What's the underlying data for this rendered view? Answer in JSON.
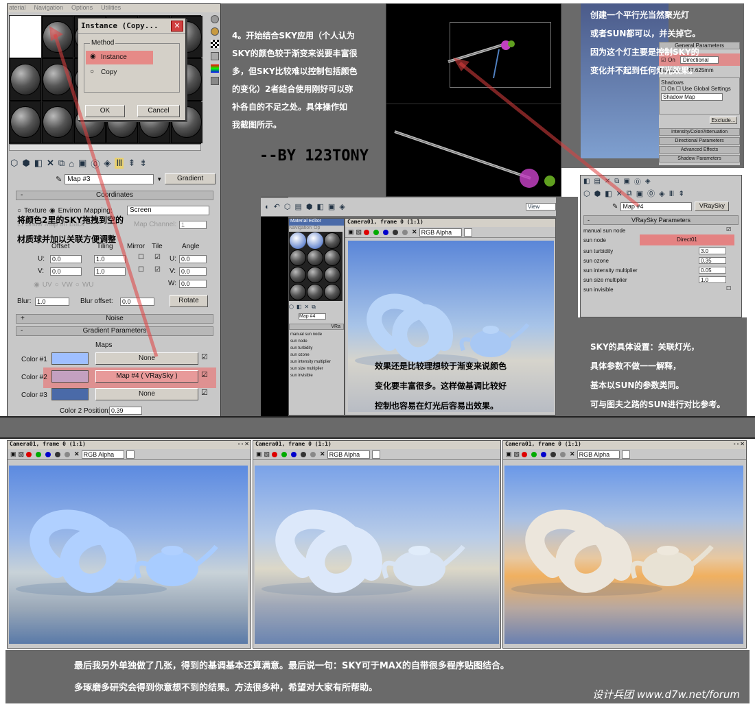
{
  "colors": {
    "bg_gray": "#6a6a6a",
    "highlight_red": "#f07070",
    "sky_blue": "#6f9be6",
    "sky_horizon": "#d8d6cc",
    "sky_warm": "#f0b060"
  },
  "menu_bar": [
    "aterial",
    "Navigation",
    "Options",
    "Utilities"
  ],
  "instance_dialog": {
    "title": "Instance (Copy...",
    "group_label": "Method",
    "option_instance": "Instance",
    "option_copy": "Copy",
    "ok": "OK",
    "cancel": "Cancel"
  },
  "material_panel": {
    "map_name": "Map #3",
    "map_type": "Gradient",
    "coordinates_title": "Coordinates",
    "texture_label": "Texture",
    "environ_label": "Environ",
    "mapping_label": "Mapping:",
    "mapping_value": "Screen",
    "show_map_label": "Show Map on Back",
    "map_channel_label": "Map Channel:",
    "map_channel_value": "1",
    "offset_label": "Offset",
    "tiling_label": "Tiling",
    "mirror_label": "Mirror",
    "tile_label": "Tile",
    "angle_label": "Angle",
    "u_label": "U:",
    "v_label": "V:",
    "w_label": "W:",
    "u_offset": "0.0",
    "v_offset": "0.0",
    "u_tiling": "1.0",
    "v_tiling": "1.0",
    "u_angle": "0.0",
    "v_angle": "0.0",
    "w_angle": "0.0",
    "uv": "UV",
    "vw": "VW",
    "wu": "WU",
    "blur_label": "Blur:",
    "blur_value": "1.0",
    "blur_offset_label": "Blur offset:",
    "blur_offset_value": "0.0",
    "rotate": "Rotate",
    "noise_title": "Noise",
    "gradient_title": "Gradient Parameters",
    "maps_label": "Maps",
    "color1": "Color #1",
    "color2": "Color #2",
    "color3": "Color #3",
    "none1": "None",
    "map4": "Map #4 ( VRaySky )",
    "none3": "None",
    "color2_pos_label": "Color 2 Position:",
    "color2_pos_value": "0.39",
    "plus": "+",
    "minus": "-",
    "color1_hex": "#9fbfff",
    "color2_hex": "#c3a0c0",
    "color3_hex": "#4a6aa8"
  },
  "annotations": {
    "drag_note_1": "将颜色2里的SKY拖拽到空的",
    "drag_note_2": "材质球并加以关联方便调整",
    "step4_lines": [
      "4。开始结合SKY应用（个人认为",
      "SKY的颜色较于渐变来说要丰富很",
      "多，但SKY比较难以控制包括颜色",
      "的变化）2者结合使用刚好可以弥",
      "补各自的不足之处。具体操作如",
      "我截图所示。"
    ],
    "author": "--BY 123TONY",
    "light_note": [
      "创建一个平行光当然聚光灯",
      "或者SUN都可以，并关掉它。",
      "因为这个灯主要是控制SKY的",
      "变化并不起到任何灯光效果。"
    ],
    "effect_note": [
      "效果还是比较理想较于渐变来说颜色",
      "变化要丰富很多。这样做基调比较好",
      "控制也容易在灯光后容易出效果。"
    ],
    "sky_note": [
      "SKY的具体设置：关联灯光，",
      "具体参数不做一一解释，",
      "基本以SUN的参数类同。",
      "可与图夫之路的SUN进行对比参考。"
    ],
    "bottom_line1": "最后我另外单独做了几张，得到的基调基本还算满意。最后说一句：SKY可于MAX的自带很多程序贴图结合。",
    "bottom_line2": "多琢磨多研究会得到你意想不到的结果。方法很多种，希望对大家有所帮助。",
    "watermark": "设计兵团 www.d7w.net/forum"
  },
  "light_panel": {
    "general_params": "General Parameters",
    "on_label": "On",
    "light_type": "Directional",
    "targeted": "Targeted:",
    "target_dist": "147.625mm",
    "shadows_label": "Shadows",
    "shadows_on": "On",
    "use_global": "Use Global Settings",
    "shadow_type": "Shadow Map",
    "exclude": "Exclude...",
    "rollouts": [
      "Intensity/Color/Attenuation",
      "Directional Parameters",
      "Advanced Effects",
      "Shadow Parameters"
    ]
  },
  "vraysky_panel": {
    "map_name": "Map #4",
    "map_type": "VRaySky",
    "title": "VRaySky Parameters",
    "manual_sun_node": "manual sun node",
    "sun_node": "sun node",
    "sun_node_value": "Direct01",
    "params": [
      {
        "label": "sun turbidity",
        "value": "3.0"
      },
      {
        "label": "sun ozone",
        "value": "0.35"
      },
      {
        "label": "sun intensity multiplier",
        "value": "0.05"
      },
      {
        "label": "sun size multiplier",
        "value": "1.0"
      }
    ],
    "sun_invisible": "sun invisible"
  },
  "mini_editor": {
    "title": "Material Editor",
    "menu_nav": "Navigation",
    "menu_opt": "Op",
    "map_name": "Map #4",
    "map_type": "VRa",
    "view": "View",
    "rollout": "VRa",
    "rows": [
      "manual sun node",
      "sun node",
      "sun turbidity",
      "sun ozone",
      "sun intensity multiplier",
      "sun size multiplier",
      "sun invisible"
    ]
  },
  "vfb": {
    "title": "Camera01, frame 0 (1:1)",
    "channel": "RGB Alpha"
  },
  "bottom_renders": [
    {
      "title": "Camera01, frame 0 (1:1)",
      "channel": "RGB Alpha"
    },
    {
      "title": "Camera01, frame 0 (1:1)",
      "channel": "RGB Alpha"
    },
    {
      "title": "Camera01, frame 0 (1:1)",
      "channel": "RGB Alpha"
    }
  ]
}
